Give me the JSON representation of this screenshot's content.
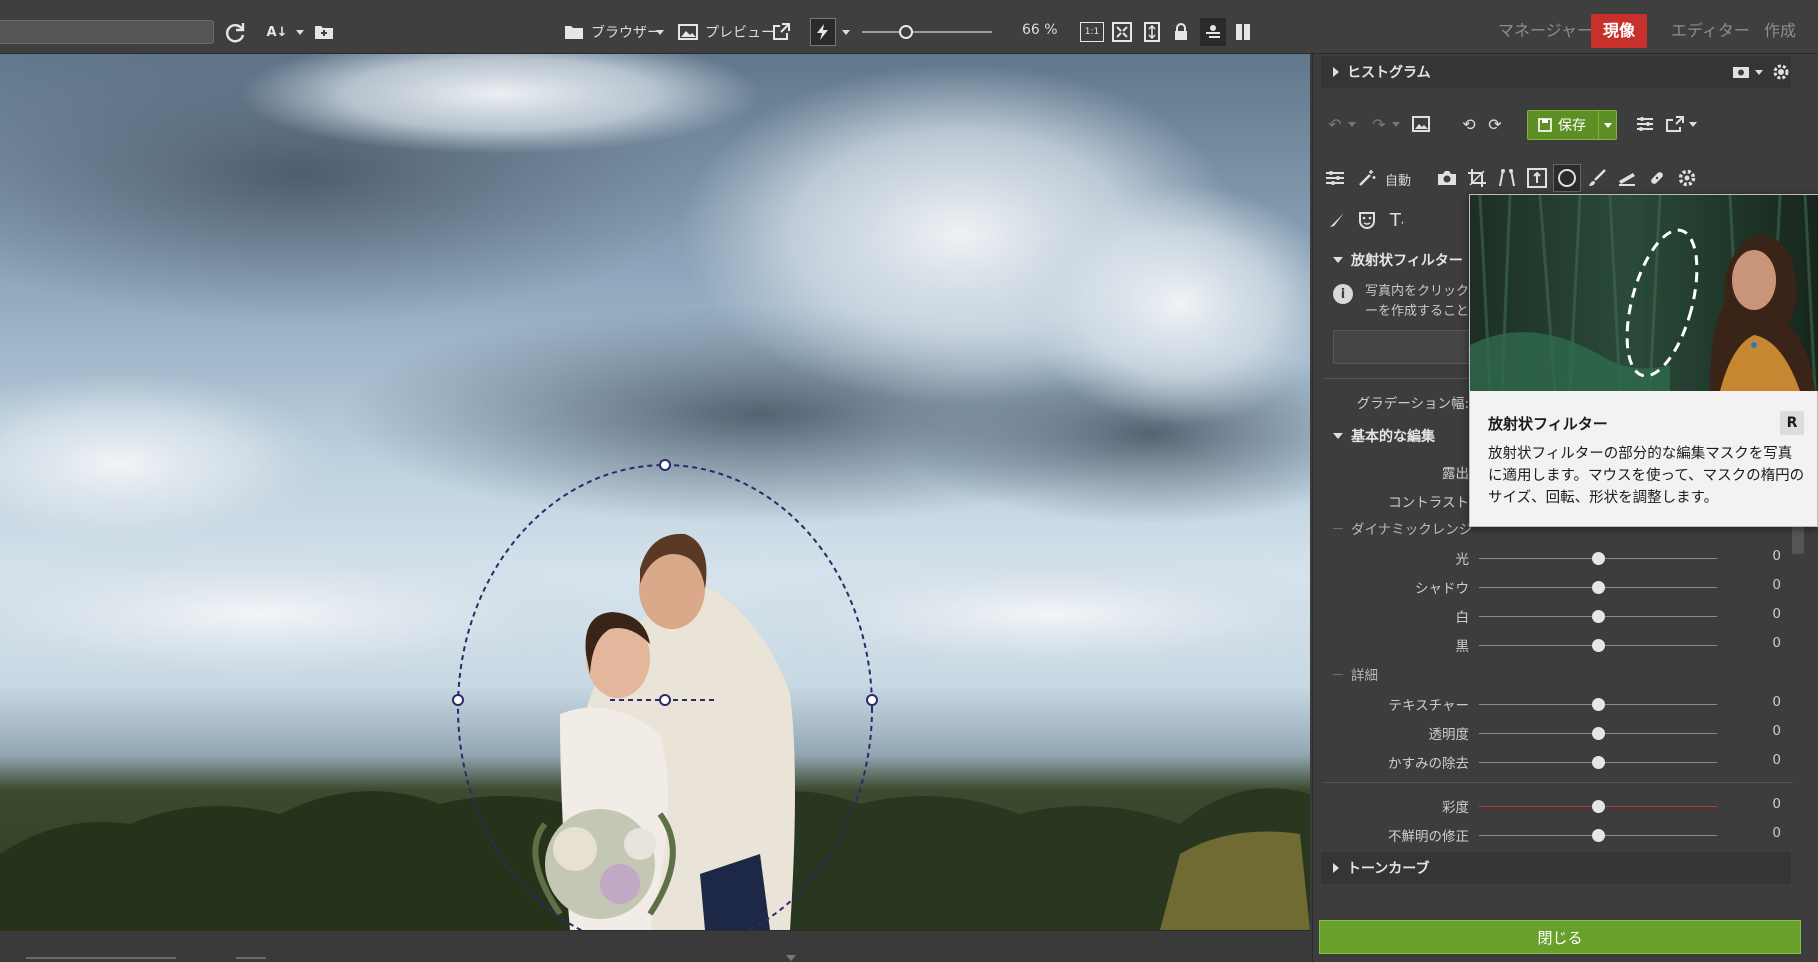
{
  "toolbar": {
    "browser_label": "ブラウザー",
    "preview_label": "プレビュー",
    "zoom_level": 0.66,
    "zoom_text": "66 %",
    "icons": [
      "refresh-icon",
      "sort-az-icon",
      "new-folder-icon",
      "external-window-icon",
      "flash-icon",
      "one-to-one-icon",
      "fit-screen-icon",
      "fit-width-icon",
      "lock-icon",
      "compare-icon",
      "split-view-icon"
    ]
  },
  "modes": [
    {
      "label": "マネージャー",
      "active": false
    },
    {
      "label": "現像",
      "active": true
    },
    {
      "label": "エディター",
      "active": false
    },
    {
      "label": "作成",
      "active": false
    }
  ],
  "panel": {
    "histogram_label": "ヒストグラム",
    "save_label": "保存",
    "auto_label": "自動",
    "radial_filter_label": "放射状フィルター",
    "info_line1": "写真内をクリックし",
    "info_line2": "ーを作成することが",
    "gradation_label": "グラデーション幅:",
    "basic_edit_label": "基本的な編集",
    "exposure_label": "露出",
    "contrast_label": "コントラスト",
    "dynamic_range_label": "ダイナミックレンジ",
    "detail_label": "詳細",
    "tone_curve_label": "トーンカーブ",
    "close_label": "閉じる",
    "sliders_dynamic": [
      {
        "label": "光",
        "value": "0",
        "fraction": 0.5
      },
      {
        "label": "シャドウ",
        "value": "0",
        "fraction": 0.5
      },
      {
        "label": "白",
        "value": "0",
        "fraction": 0.5
      },
      {
        "label": "黒",
        "value": "0",
        "fraction": 0.5
      }
    ],
    "sliders_detail": [
      {
        "label": "テキスチャー",
        "value": "0",
        "fraction": 0.5
      },
      {
        "label": "透明度",
        "value": "0",
        "fraction": 0.5
      },
      {
        "label": "かすみの除去",
        "value": "0",
        "fraction": 0.5
      }
    ],
    "sliders_color": [
      {
        "label": "彩度",
        "value": "0",
        "fraction": 0.5
      },
      {
        "label": "不鮮明の修正",
        "value": "0",
        "fraction": 0.5
      }
    ]
  },
  "tooltip": {
    "title": "放射状フィルター",
    "shortcut": "R",
    "description": "放射状フィルターの部分的な編集マスクを写真に適用します。マウスを使って、マスクの楕円のサイズ、回転、形状を調整します。"
  },
  "colors": {
    "active_mode": "#c8302c",
    "save_green": "#5d8f25",
    "close_green": "#67a12b",
    "saturation_track": "#b23a3a"
  }
}
